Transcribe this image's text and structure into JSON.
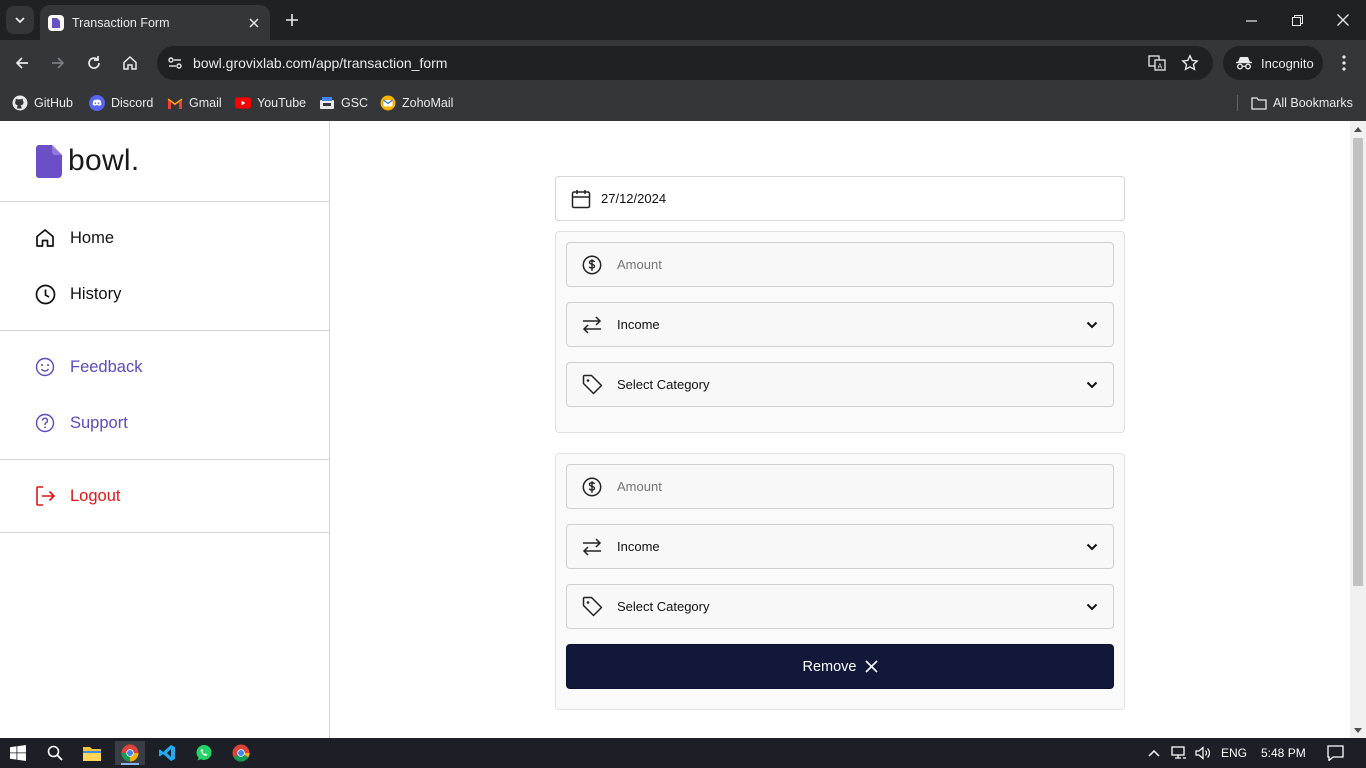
{
  "browser": {
    "tab_title": "Transaction Form",
    "url": "bowl.grovixlab.com/app/transaction_form",
    "incognito_label": "Incognito",
    "all_bookmarks_label": "All Bookmarks",
    "bookmarks": [
      {
        "label": "GitHub",
        "icon": "github-icon"
      },
      {
        "label": "Discord",
        "icon": "discord-icon"
      },
      {
        "label": "Gmail",
        "icon": "gmail-icon"
      },
      {
        "label": "YouTube",
        "icon": "youtube-icon"
      },
      {
        "label": "GSC",
        "icon": "gsc-icon"
      },
      {
        "label": "ZohoMail",
        "icon": "zohomail-icon"
      }
    ]
  },
  "app": {
    "brand": "bowl.",
    "brand_color": "#6a4fc7",
    "nav_primary": [
      {
        "label": "Home",
        "icon": "home-icon"
      },
      {
        "label": "History",
        "icon": "clock-icon"
      }
    ],
    "nav_secondary": [
      {
        "label": "Feedback",
        "icon": "smile-icon"
      },
      {
        "label": "Support",
        "icon": "help-circle-icon"
      }
    ],
    "logout_label": "Logout",
    "accent_color": "#5b4bbd",
    "danger_color": "#e01616"
  },
  "form": {
    "date_value": "27/12/2024",
    "transactions": [
      {
        "amount_placeholder": "Amount",
        "amount_value": "",
        "type_selected": "Income",
        "category_selected": "Select Category"
      },
      {
        "amount_placeholder": "Amount",
        "amount_value": "",
        "type_selected": "Income",
        "category_selected": "Select Category"
      }
    ],
    "remove_label": "Remove",
    "remove_button_color": "#12183a"
  },
  "taskbar": {
    "language": "ENG",
    "time": "5:48 PM"
  }
}
